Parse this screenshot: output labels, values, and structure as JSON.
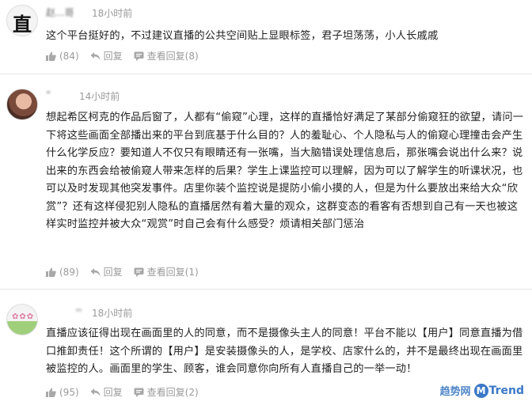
{
  "comments": [
    {
      "username": "赵...哥",
      "time": "18小时前",
      "text": "这个平台挺好的，不过建议直播的公共空间贴上显眼标签，君子坦荡荡，小人长戚戚",
      "likes": "(84)",
      "reply": "回复",
      "view_replies": "查看回复(8)"
    },
    {
      "username": "“",
      "time": "14小时前",
      "text": "想起希区柯克的作品后窗了，人都有“偷窥”心理，这样的直播恰好满足了某部分偷窥狂的欲望，请问一下将这些画面全部播出来的平台到底基于什么目的？人的羞耻心、个人隐私与人的偷窥心理撞击会产生什么化学反应？要知道人不仅只有眼睛还有一张嘴，当大脑错误处理信息后，那张嘴会说出什么来？说出来的东西会给被偷窥人带来怎样的后果？学生上课监控可以理解，因为可以了解学生的听课状况，也可以及时发现其他突发事件。店里你装个监控说是提防小偷小摸的人，但是为什么要放出来给大众“欣赏”？还有这样侵犯别人隐私的直播居然有着大量的观众，这群变态的看客有否想到自己有一天也被这样实时监控并被大众“观赏”时自己会有什么感受？烦请相关部门惩治",
      "likes": "(89)",
      "reply": "回复",
      "view_replies": "查看回复(1)"
    },
    {
      "username": "ᵐ",
      "time": "18小时前",
      "text": "直播应该征得出现在画面里的人的同意，而不是摄像头主人的同意！平台不能以【用户】同意直播为借口推卸责任！这个所谓的【用户】是安装摄像头的人，是学校、店家什么的，并不是最终出现在画面里被监控的人。画面里的学生、顾客，谁会同意你向所有人直播自己的一举一动！",
      "likes": "(95)",
      "reply": "回复",
      "view_replies": "查看回复(2)"
    }
  ],
  "watermark": {
    "cn": "趋势网",
    "m": "M",
    "en": "Trend"
  },
  "colors": {
    "meta": "#999999",
    "text": "#1f1f1f",
    "watermark": "#3b78c8"
  },
  "icons": [
    "thumb-up-icon",
    "reply-icon",
    "view-replies-icon"
  ]
}
